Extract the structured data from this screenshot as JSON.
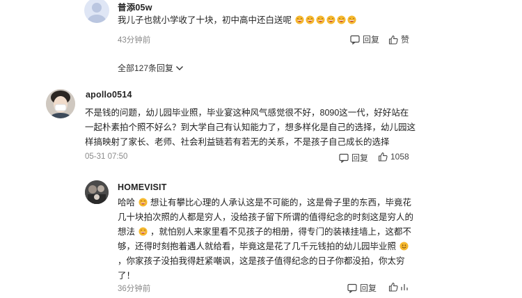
{
  "comments": {
    "top": {
      "username": "普添05w",
      "text": "我儿子也就小学收了十块，初中高中还白送呢",
      "emoji_count": 6,
      "time": "43分钟前",
      "reply_label": "回复",
      "like_label": "赞"
    },
    "expand_all": "全部127条回复",
    "apollo": {
      "username": "apollo0514",
      "lines": [
        "不是钱的问题，幼儿园毕业照，毕业宴这种风气感觉很不好，8090这一代，好好站在",
        "一起朴素拍个照不好么？到大学自己有认知能力了，想多样化是自己的选择，幼儿园这",
        "样搞映射了家长、老师、社会利益链若有若无的关系，不是孩子自己成长的选择"
      ],
      "time": "05-31 07:50",
      "reply_label": "回复",
      "like_count": "1058"
    },
    "homevisit": {
      "username": "HOMEVISIT",
      "line1_a": "哈哈",
      "line1_b": "想让有攀比心理的人承认这是不可能的，这是骨子里的东西，毕竟花",
      "line2": "几十块拍次照的人都是穷人，没给孩子留下所谓的值得纪念的时刻这是穷人的",
      "line3_a": "想法",
      "line3_b": "，就怕别人来家里看不见孩子的相册，得专门的装裱挂墙上，这都不",
      "line4_a": "够，还得时刻抱着遇人就给看，毕竟这是花了几千元钱拍的幼儿园毕业照",
      "line5": "，你家孩子没拍我得赶紧嘲讽，这是孩子值得纪念的日子你都没拍，你太穷",
      "line6": "了！",
      "time": "36分钟前",
      "reply_label": "回复"
    }
  },
  "colors": {
    "meta": "#8a8a8a",
    "emoji_face": "#f5b82e",
    "emoji_mouth": "#c0392b"
  }
}
